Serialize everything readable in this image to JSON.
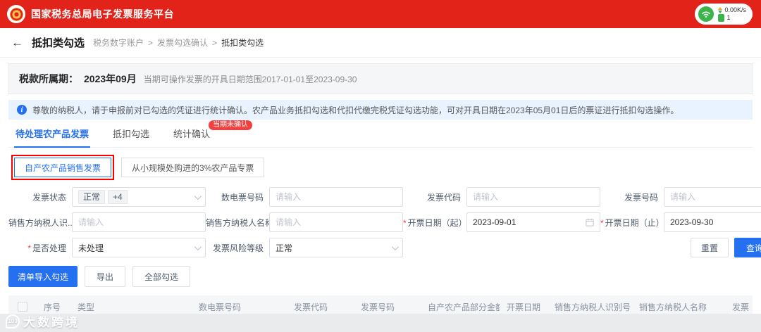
{
  "ui": {
    "required_mark": "*",
    "separator": ">"
  },
  "header": {
    "title": "国家税务总局电子发票服务平台",
    "network": {
      "speed": "0.00K/s",
      "count": "1"
    }
  },
  "nav": {
    "back_icon": "←",
    "title": "抵扣类勾选",
    "crumbs": [
      "税务数字账户",
      "发票勾选确认",
      "抵扣类勾选"
    ]
  },
  "period": {
    "label": "税款所属期：",
    "value": "2023年09月",
    "hint": "当期可操作发票的开具日期范围2017-01-01至2023-09-30"
  },
  "notice": {
    "icon": "i",
    "text": "尊敬的纳税人，请于申报前对已勾选的凭证进行统计确认。农产品业务抵扣勾选和代扣代缴完税凭证勾选功能，可对开具日期在2023年05月01日后的票证进行抵扣勾选操作。"
  },
  "tabs": [
    {
      "label": "待处理农产品发票"
    },
    {
      "label": "抵扣勾选"
    },
    {
      "label": "统计确认",
      "badge": "当期未确认"
    }
  ],
  "subtabs": [
    {
      "label": "自产农产品销售发票"
    },
    {
      "label": "从小规模处购进的3%农产品专票"
    }
  ],
  "filters": {
    "invoice_status": {
      "label": "发票状态",
      "tag": "正常",
      "more": "+4"
    },
    "digital_no": {
      "label": "数电票号码",
      "placeholder": "请输入"
    },
    "invoice_code": {
      "label": "发票代码",
      "placeholder": "请输入"
    },
    "invoice_no": {
      "label": "发票号码",
      "placeholder": "请输入"
    },
    "seller_taxid": {
      "label": "销售方纳税人识...",
      "placeholder": "请输入"
    },
    "seller_name": {
      "label": "销售方纳税人名称",
      "placeholder": "请输入"
    },
    "date_start": {
      "label": "开票日期（起）",
      "value": "2023-09-01"
    },
    "date_end": {
      "label": "开票日期（止）",
      "value": "2023-09-30"
    },
    "processed": {
      "label": "是否处理",
      "value": "未处理"
    },
    "risk_level": {
      "label": "发票风险等级",
      "value": "正常"
    }
  },
  "actions": {
    "reset": "重置",
    "query": "查询",
    "import_select": "清单导入勾选",
    "export": "导出",
    "select_all": "全部勾选"
  },
  "table": {
    "columns": [
      "序号",
      "类型",
      "数电票号码",
      "发票代码",
      "发票号码",
      "自产农产品部分金额",
      "开票日期",
      "销售方纳税人识别号",
      "销售方纳税人名称",
      "发票"
    ]
  },
  "watermark": {
    "logo": "100",
    "text": "大数跨境"
  }
}
